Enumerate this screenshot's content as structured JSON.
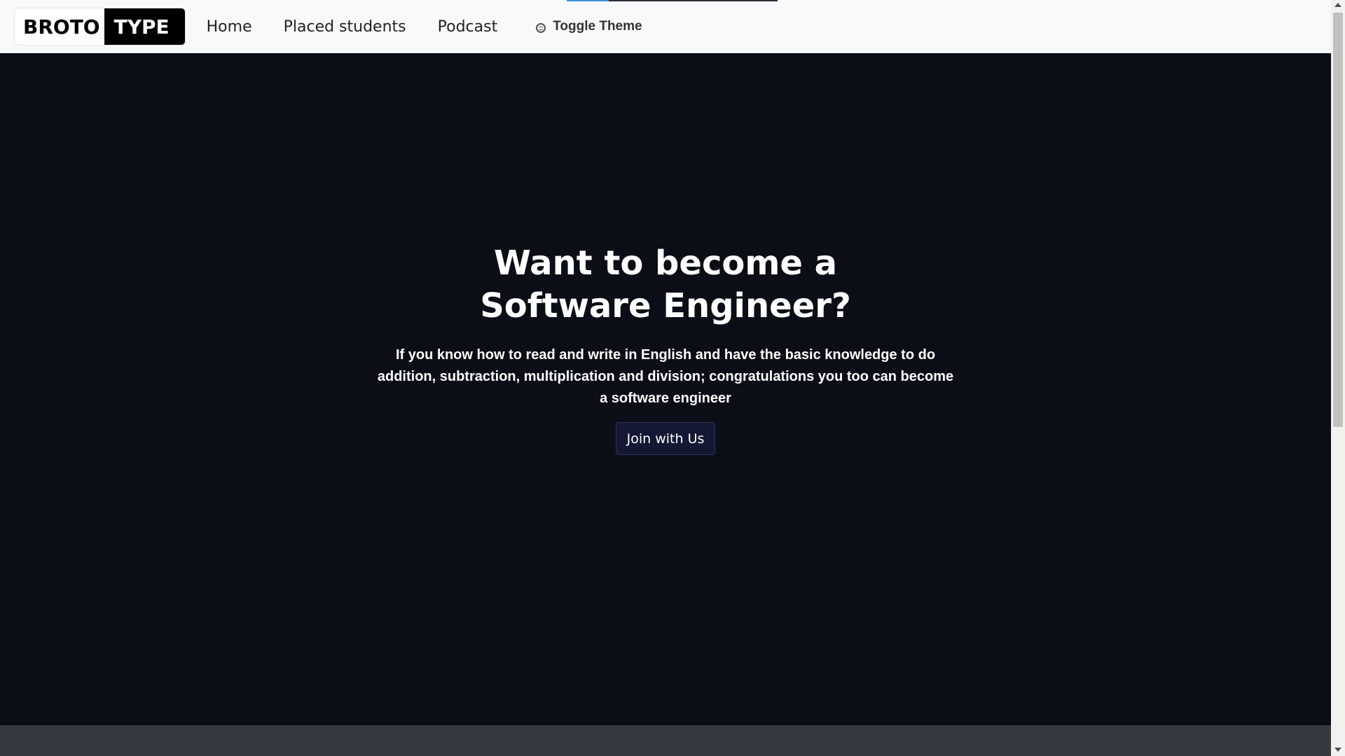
{
  "page_load_progress": 0.2,
  "brand": {
    "part1": "BROTO",
    "part2": "TYPE"
  },
  "nav": {
    "home": "Home",
    "placed_students": "Placed students",
    "podcast": "Podcast",
    "toggle_theme": "Toggle Theme"
  },
  "hero": {
    "title_line1": "Want to become a",
    "title_line2": "Software Engineer?",
    "description": "If you know how to read and write in English and have the basic knowledge to do addition, subtraction, multiplication and division; congratulations you too can become a software engineer",
    "cta": "Join with Us"
  },
  "colors": {
    "navbar_bg": "#f8f9fa",
    "hero_bg": "#0b0e17",
    "button_bg": "#141833",
    "footer_bg": "#343a40",
    "progress": "#3b8fd9"
  },
  "icons": {
    "toggle_theme": "theme-toggle-icon"
  }
}
